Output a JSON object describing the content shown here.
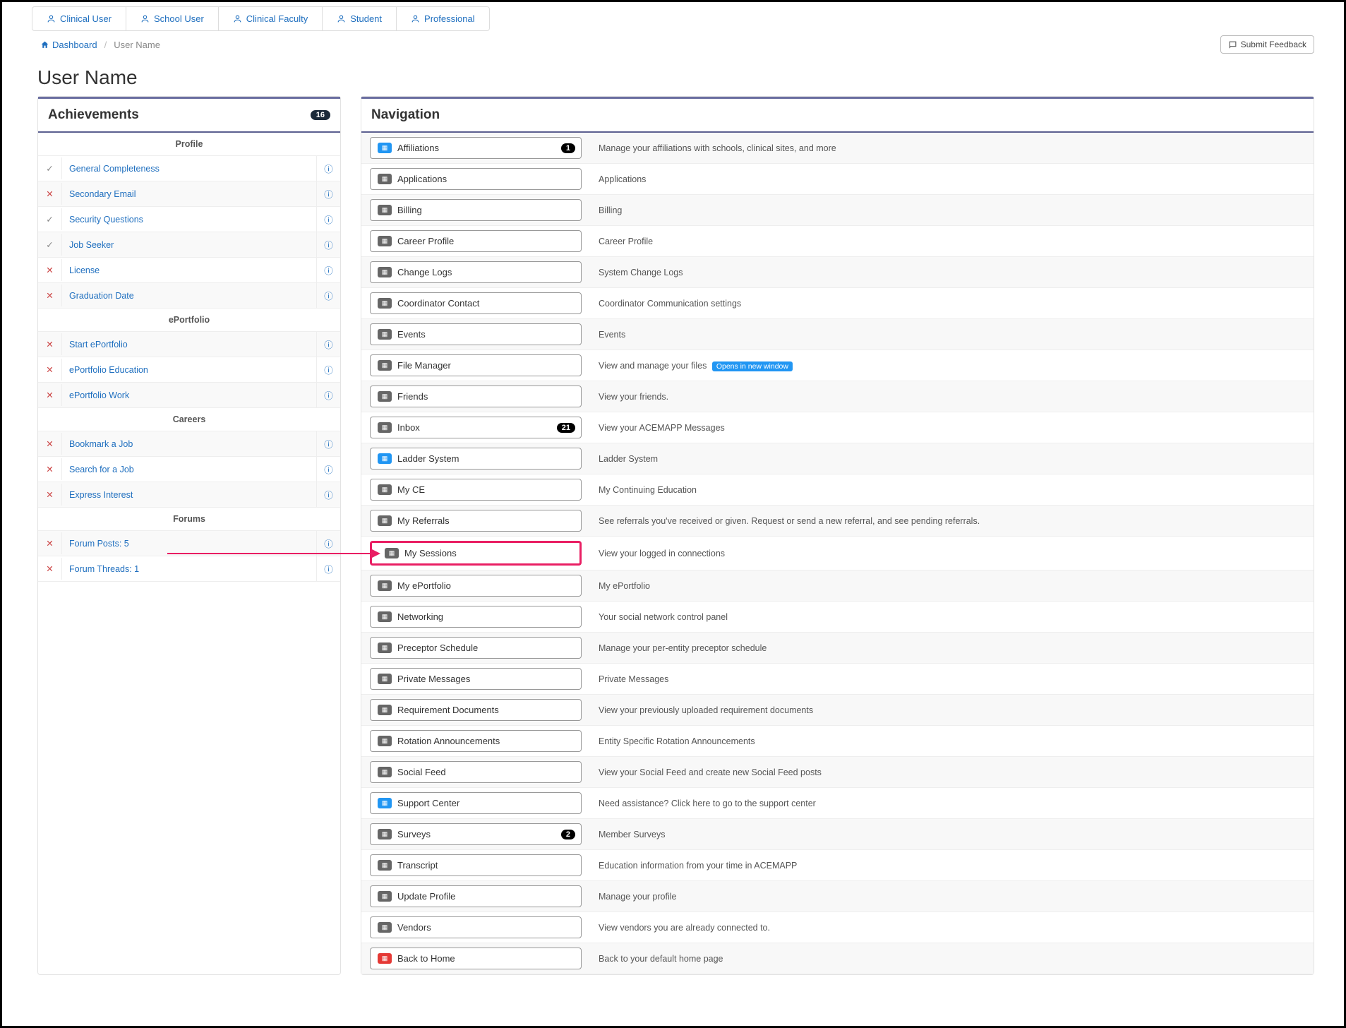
{
  "tabs": [
    "Clinical User",
    "School User",
    "Clinical Faculty",
    "Student",
    "Professional"
  ],
  "breadcrumb": {
    "home": "Dashboard",
    "current": "User Name"
  },
  "feedback_label": "Submit Feedback",
  "page_title": "User Name",
  "achievements": {
    "title": "Achievements",
    "count": "16",
    "sections": [
      {
        "label": "Profile",
        "items": [
          {
            "status": "check",
            "label": "General Completeness"
          },
          {
            "status": "x",
            "label": "Secondary Email"
          },
          {
            "status": "check",
            "label": "Security Questions"
          },
          {
            "status": "check",
            "label": "Job Seeker"
          },
          {
            "status": "x",
            "label": "License"
          },
          {
            "status": "x",
            "label": "Graduation Date"
          }
        ]
      },
      {
        "label": "ePortfolio",
        "items": [
          {
            "status": "x",
            "label": "Start ePortfolio"
          },
          {
            "status": "x",
            "label": "ePortfolio Education"
          },
          {
            "status": "x",
            "label": "ePortfolio Work"
          }
        ]
      },
      {
        "label": "Careers",
        "items": [
          {
            "status": "x",
            "label": "Bookmark a Job"
          },
          {
            "status": "x",
            "label": "Search for a Job"
          },
          {
            "status": "x",
            "label": "Express Interest"
          }
        ]
      },
      {
        "label": "Forums",
        "items": [
          {
            "status": "x",
            "label": "Forum Posts: 5"
          },
          {
            "status": "x",
            "label": "Forum Threads: 1"
          }
        ]
      }
    ]
  },
  "navigation": {
    "title": "Navigation",
    "highlight_index": 14,
    "chip_label": "Opens in new window",
    "rows": [
      {
        "label": "Affiliations",
        "desc": "Manage your affiliations with schools, clinical sites, and more",
        "badge": "1",
        "color": "blue"
      },
      {
        "label": "Applications",
        "desc": "Applications"
      },
      {
        "label": "Billing",
        "desc": "Billing"
      },
      {
        "label": "Career Profile",
        "desc": "Career Profile"
      },
      {
        "label": "Change Logs",
        "desc": "System Change Logs"
      },
      {
        "label": "Coordinator Contact",
        "desc": "Coordinator Communication settings"
      },
      {
        "label": "Events",
        "desc": "Events"
      },
      {
        "label": "File Manager",
        "desc": "View and manage your files",
        "chip": true
      },
      {
        "label": "Friends",
        "desc": "View your friends."
      },
      {
        "label": "Inbox",
        "desc": "View your ACEMAPP Messages",
        "badge": "21"
      },
      {
        "label": "Ladder System",
        "desc": "Ladder System",
        "color": "blue"
      },
      {
        "label": "My CE",
        "desc": "My Continuing Education"
      },
      {
        "label": "My Referrals",
        "desc": "See referrals you've received or given. Request or send a new referral, and see pending referrals."
      },
      {
        "label": "My Sessions",
        "desc": "View your logged in connections"
      },
      {
        "label": "My ePortfolio",
        "desc": "My ePortfolio"
      },
      {
        "label": "Networking",
        "desc": "Your social network control panel"
      },
      {
        "label": "Preceptor Schedule",
        "desc": "Manage your per-entity preceptor schedule"
      },
      {
        "label": "Private Messages",
        "desc": "Private Messages"
      },
      {
        "label": "Requirement Documents",
        "desc": "View your previously uploaded requirement documents"
      },
      {
        "label": "Rotation Announcements",
        "desc": "Entity Specific Rotation Announcements"
      },
      {
        "label": "Social Feed",
        "desc": "View your Social Feed and create new Social Feed posts"
      },
      {
        "label": "Support Center",
        "desc": "Need assistance? Click here to go to the support center",
        "color": "blue"
      },
      {
        "label": "Surveys",
        "desc": "Member Surveys",
        "badge": "2"
      },
      {
        "label": "Transcript",
        "desc": "Education information from your time in ACEMAPP"
      },
      {
        "label": "Update Profile",
        "desc": "Manage your profile"
      },
      {
        "label": "Vendors",
        "desc": "View vendors you are already connected to."
      },
      {
        "label": "Back to Home",
        "desc": "Back to your default home page",
        "color": "red"
      }
    ]
  }
}
